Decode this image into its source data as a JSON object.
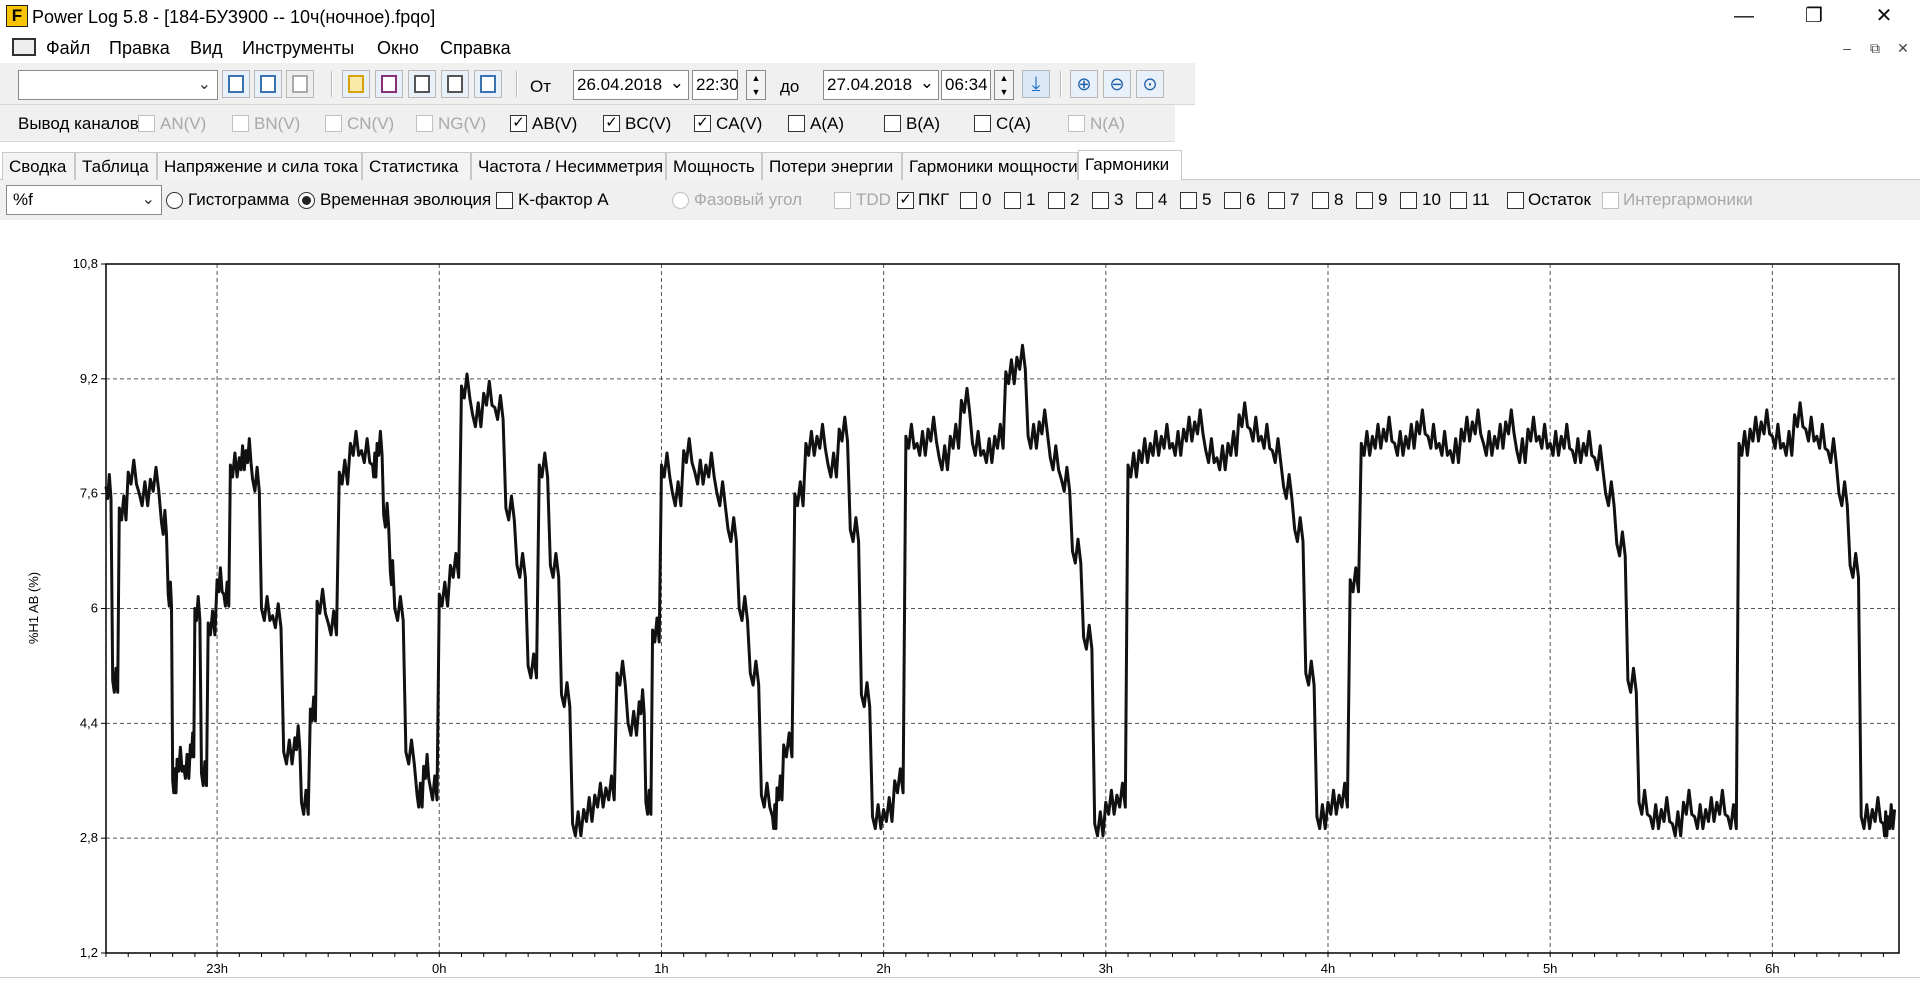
{
  "window": {
    "title": "Power Log 5.8 - [184-БУ3900 -- 10ч(ночное).fpqo]",
    "icon_letter": "F",
    "minimize": "—",
    "restore": "❐",
    "close": "✕"
  },
  "menu": [
    "Файл",
    "Правка",
    "Вид",
    "Инструменты",
    "Окно",
    "Справка"
  ],
  "toolbar": {
    "combo_value": "",
    "from_label": "От",
    "from_date": "26.04.2018",
    "from_time": "22:30",
    "to_label": "до",
    "to_date": "27.04.2018",
    "to_time": "06:34"
  },
  "channels": {
    "label": "Вывод каналов",
    "items": [
      {
        "label": "AN(V)",
        "checked": false,
        "enabled": false
      },
      {
        "label": "BN(V)",
        "checked": false,
        "enabled": false
      },
      {
        "label": "CN(V)",
        "checked": false,
        "enabled": false
      },
      {
        "label": "NG(V)",
        "checked": false,
        "enabled": false
      },
      {
        "label": "AB(V)",
        "checked": true,
        "enabled": true
      },
      {
        "label": "BC(V)",
        "checked": true,
        "enabled": true
      },
      {
        "label": "CA(V)",
        "checked": true,
        "enabled": true
      },
      {
        "label": "A(A)",
        "checked": false,
        "enabled": true
      },
      {
        "label": "B(A)",
        "checked": false,
        "enabled": true
      },
      {
        "label": "C(A)",
        "checked": false,
        "enabled": true
      },
      {
        "label": "N(A)",
        "checked": false,
        "enabled": false
      }
    ]
  },
  "tabs": [
    "Сводка",
    "Таблица",
    "Напряжение и сила тока",
    "Статистика",
    "Частота / Несимметрия",
    "Мощность",
    "Потери энергии",
    "Гармоники мощности",
    "Гармоники"
  ],
  "active_tab": "Гармоники",
  "options": {
    "unit_select": "%f",
    "histogram": "Гистограмма",
    "time_evolution": "Временная эволюция",
    "k_factor": "K-фактор A",
    "phase_angle": "Фазовый угол",
    "tdd": "TDD",
    "pkg": "ПКГ",
    "harmonics": [
      "0",
      "1",
      "2",
      "3",
      "4",
      "5",
      "6",
      "7",
      "8",
      "9",
      "10",
      "11"
    ],
    "remainder": "Остаток",
    "interharmonics": "Интергармоники"
  },
  "chart_data": {
    "type": "line",
    "title": "",
    "ylabel": "%H1 AB (%)",
    "xlabel": "",
    "ylim": [
      1.2,
      10.8
    ],
    "yticks": [
      "10,8",
      "9,2",
      "7,6",
      "6",
      "4,4",
      "2,8",
      "1,2"
    ],
    "xticks": [
      "23h",
      "0h",
      "1h",
      "2h",
      "3h",
      "4h",
      "5h",
      "6h"
    ],
    "xlim_hours": [
      22.5,
      30.57
    ],
    "grid": "dashed",
    "series": [
      {
        "x": [
          22.5,
          22.53,
          22.56,
          22.6,
          22.65,
          22.7,
          22.75,
          22.78,
          22.8,
          22.82,
          22.85,
          22.88,
          22.9,
          22.93,
          22.96,
          23.0,
          23.03,
          23.06,
          23.1,
          23.13,
          23.16,
          23.2,
          23.25,
          23.3,
          23.35,
          23.38,
          23.42,
          23.45,
          23.5,
          23.55,
          23.6,
          23.65,
          23.7,
          23.72,
          23.75,
          23.78,
          23.8,
          23.85,
          23.9,
          23.93,
          23.96,
          24.0,
          24.05,
          24.1,
          24.15,
          24.2,
          24.25,
          24.3,
          24.35,
          24.4,
          24.45,
          24.5,
          24.55,
          24.6,
          24.65,
          24.7,
          24.75,
          24.8,
          24.85,
          24.9,
          24.93,
          24.96,
          25.0,
          25.05,
          25.1,
          25.15,
          25.2,
          25.25,
          25.3,
          25.35,
          25.4,
          25.45,
          25.5,
          25.52,
          25.55,
          25.6,
          25.65,
          25.7,
          25.75,
          25.8,
          25.85,
          25.9,
          25.95,
          26.0,
          26.05,
          26.1,
          26.15,
          26.2,
          26.25,
          26.3,
          26.35,
          26.4,
          26.45,
          26.5,
          26.55,
          26.6,
          26.65,
          26.7,
          26.75,
          26.8,
          26.85,
          26.9,
          26.95,
          27.0,
          27.05,
          27.1,
          27.15,
          27.2,
          27.25,
          27.3,
          27.35,
          27.4,
          27.45,
          27.5,
          27.55,
          27.6,
          27.65,
          27.7,
          27.75,
          27.8,
          27.85,
          27.9,
          27.95,
          28.0,
          28.05,
          28.1,
          28.15,
          28.2,
          28.25,
          28.3,
          28.35,
          28.4,
          28.45,
          28.5,
          28.55,
          28.6,
          28.65,
          28.7,
          28.75,
          28.8,
          28.85,
          28.9,
          28.95,
          29.0,
          29.05,
          29.1,
          29.15,
          29.2,
          29.25,
          29.3,
          29.35,
          29.4,
          29.45,
          29.5,
          29.55,
          29.6,
          29.65,
          29.7,
          29.75,
          29.8,
          29.85,
          29.9,
          29.95,
          30.0,
          30.05,
          30.1,
          30.15,
          30.2,
          30.25,
          30.3,
          30.35,
          30.4,
          30.45,
          30.5,
          30.52,
          30.55
        ],
        "y": [
          7.7,
          5.0,
          7.4,
          7.9,
          7.6,
          7.8,
          7.2,
          6.2,
          3.6,
          3.9,
          3.8,
          4.1,
          6.0,
          3.7,
          5.8,
          6.4,
          6.2,
          8.0,
          8.1,
          8.2,
          7.8,
          6.0,
          5.9,
          4.0,
          4.2,
          3.3,
          4.6,
          6.1,
          5.8,
          7.9,
          8.3,
          8.2,
          8.0,
          8.3,
          7.3,
          6.5,
          6.0,
          4.0,
          3.4,
          3.8,
          3.5,
          6.2,
          6.6,
          9.1,
          8.7,
          9.0,
          8.8,
          7.4,
          6.6,
          5.2,
          8.0,
          6.6,
          4.8,
          3.0,
          3.2,
          3.4,
          3.5,
          5.1,
          4.4,
          4.7,
          3.3,
          5.7,
          8.0,
          7.6,
          8.2,
          7.9,
          8.0,
          7.6,
          7.1,
          6.0,
          5.1,
          3.4,
          3.1,
          3.5,
          4.1,
          7.6,
          8.3,
          8.4,
          8.0,
          8.5,
          7.1,
          4.8,
          3.1,
          3.2,
          3.6,
          8.4,
          8.3,
          8.5,
          8.1,
          8.4,
          8.9,
          8.3,
          8.2,
          8.4,
          9.3,
          9.5,
          8.4,
          8.6,
          8.1,
          7.8,
          6.8,
          5.6,
          3.0,
          3.3,
          3.4,
          8.0,
          8.2,
          8.3,
          8.4,
          8.3,
          8.5,
          8.6,
          8.2,
          8.1,
          8.3,
          8.7,
          8.5,
          8.4,
          8.2,
          7.7,
          7.1,
          5.1,
          3.1,
          3.3,
          3.4,
          6.4,
          8.3,
          8.4,
          8.5,
          8.3,
          8.4,
          8.6,
          8.4,
          8.3,
          8.2,
          8.5,
          8.6,
          8.3,
          8.4,
          8.6,
          8.2,
          8.5,
          8.4,
          8.3,
          8.4,
          8.2,
          8.3,
          8.1,
          7.6,
          6.9,
          5.0,
          3.3,
          3.1,
          3.2,
          3.0,
          3.3,
          3.1,
          3.2,
          3.3,
          3.1,
          8.3,
          8.5,
          8.6,
          8.4,
          8.3,
          8.7,
          8.5,
          8.4,
          8.2,
          7.6,
          6.6,
          3.1,
          3.2,
          3.0,
          3.1,
          3.2
        ],
        "note": ""
      }
    ]
  }
}
